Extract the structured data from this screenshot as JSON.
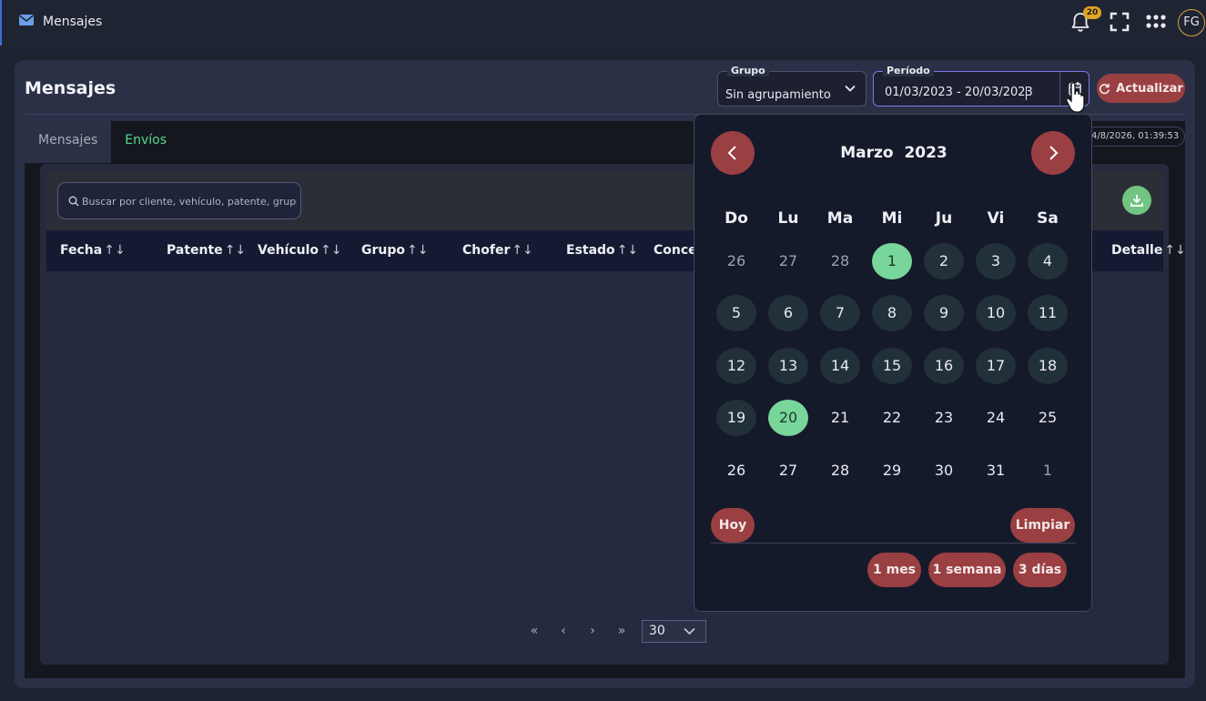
{
  "topbar": {
    "title": "Mensajes",
    "app_icon": "envelope-icon",
    "notifications_count": "20",
    "icons": [
      "bell-icon",
      "fullscreen-icon",
      "apps-grid-icon"
    ],
    "avatar_initials": "FG"
  },
  "page": {
    "title": "Mensajes",
    "grupo": {
      "label": "Grupo",
      "value": "Sin agrupamiento"
    },
    "periodo": {
      "label": "Período",
      "value": "01/03/2023 - 20/03/2023"
    },
    "refresh_label": "Actualizar",
    "timestamp": "4/8/2026, 01:39:53"
  },
  "tabs": [
    {
      "label": "Mensajes",
      "active": true
    },
    {
      "label": "Envíos",
      "active": false
    }
  ],
  "search": {
    "placeholder": "Buscar por cliente, vehículo, patente, grupo,"
  },
  "table": {
    "columns": [
      "Fecha",
      "Patente",
      "Vehículo",
      "Grupo",
      "Chofer",
      "Estado",
      "Conce",
      "Detalle"
    ],
    "sort_glyph": "↑↓"
  },
  "pager": {
    "first": "«",
    "prev": "‹",
    "next": "›",
    "last": "»",
    "page_size": "30"
  },
  "datepicker": {
    "month": "Marzo",
    "year": "2023",
    "weekdays": [
      "Do",
      "Lu",
      "Ma",
      "Mi",
      "Ju",
      "Vi",
      "Sa"
    ],
    "weeks": [
      [
        "26",
        "27",
        "28",
        "1",
        "2",
        "3",
        "4"
      ],
      [
        "5",
        "6",
        "7",
        "8",
        "9",
        "10",
        "11"
      ],
      [
        "12",
        "13",
        "14",
        "15",
        "16",
        "17",
        "18"
      ],
      [
        "19",
        "20",
        "21",
        "22",
        "23",
        "24",
        "25"
      ],
      [
        "26",
        "27",
        "28",
        "29",
        "30",
        "31",
        "1"
      ]
    ],
    "buttons": {
      "today": "Hoy",
      "clear": "Limpiar",
      "one_month": "1 mes",
      "one_week": "1 semana",
      "three_days": "3 días"
    }
  },
  "colors": {
    "accent_red": "#9a3f42",
    "accent_green": "#58d98b",
    "selected_day": "#79d69b",
    "range_day": "#223039",
    "badge": "#e0a521",
    "focus_border": "#7b79e8"
  }
}
